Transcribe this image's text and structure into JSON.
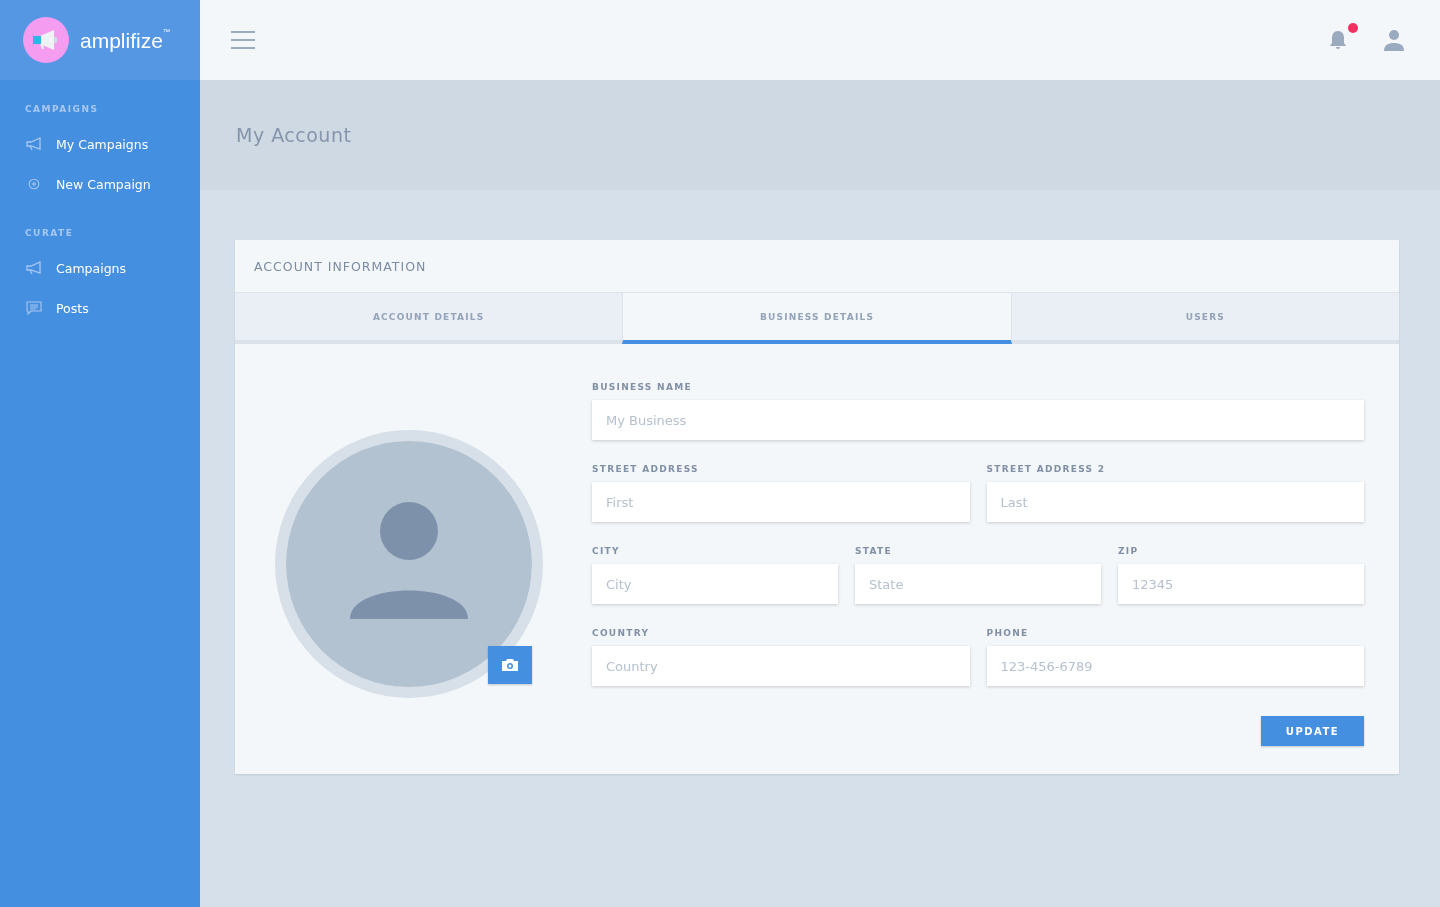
{
  "brand": {
    "name": "amplifize",
    "trademark": "™"
  },
  "sidebar": {
    "sections": [
      {
        "title": "CAMPAIGNS",
        "items": [
          {
            "label": "My Campaigns",
            "kind": "megaphone"
          },
          {
            "label": "New Campaign",
            "kind": "plus"
          }
        ]
      },
      {
        "title": "CURATE",
        "items": [
          {
            "label": "Campaigns",
            "kind": "megaphone"
          },
          {
            "label": "Posts",
            "kind": "chat"
          }
        ]
      }
    ]
  },
  "header": {
    "has_unread_notifications": true
  },
  "page_title": "My Account",
  "card": {
    "title": "ACCOUNT INFORMATION",
    "tabs": [
      {
        "label": "ACCOUNT DETAILS",
        "selected": false
      },
      {
        "label": "BUSINESS DETAILS",
        "selected": true
      },
      {
        "label": "USERS",
        "selected": false
      }
    ],
    "form_rows": [
      [
        {
          "label": "BUSINESS NAME",
          "placeholder": "My Business"
        }
      ],
      [
        {
          "label": "STREET ADDRESS",
          "placeholder": "First"
        },
        {
          "label": "STREET ADDRESS 2",
          "placeholder": "Last"
        }
      ],
      [
        {
          "label": "CITY",
          "placeholder": "City"
        },
        {
          "label": "STATE",
          "placeholder": "State"
        },
        {
          "label": "ZIP",
          "placeholder": "12345"
        }
      ],
      [
        {
          "label": "COUNTRY",
          "placeholder": "Country"
        },
        {
          "label": "PHONE",
          "placeholder": "123-456-6789"
        }
      ]
    ],
    "update_button": "UPDATE"
  }
}
